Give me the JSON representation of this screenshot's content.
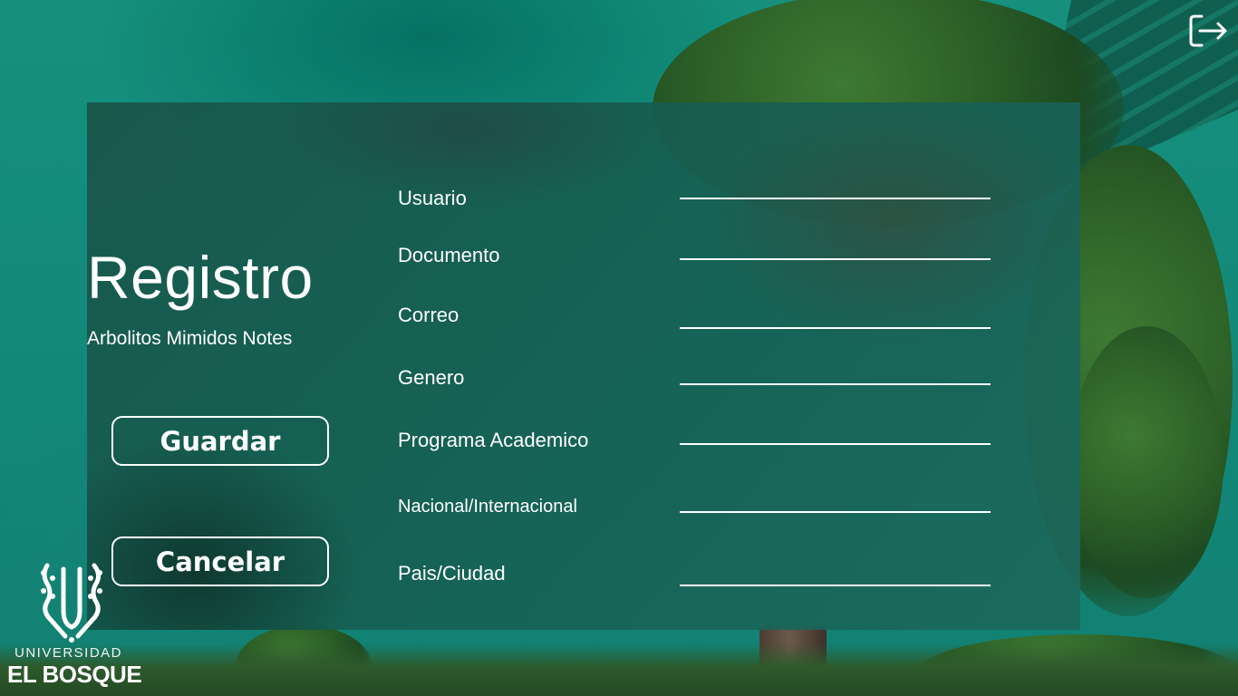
{
  "form": {
    "title": "Registro",
    "subtitle": "Arbolitos Mimidos Notes",
    "fields": [
      {
        "label": "Usuario",
        "value": ""
      },
      {
        "label": "Documento",
        "value": ""
      },
      {
        "label": "Correo",
        "value": ""
      },
      {
        "label": "Genero",
        "value": ""
      },
      {
        "label": "Programa Academico",
        "value": ""
      },
      {
        "label": "Nacional/Internacional",
        "value": ""
      },
      {
        "label": "Pais/Ciudad",
        "value": ""
      }
    ]
  },
  "buttons": {
    "save_label": "Guardar",
    "cancel_label": "Cancelar"
  },
  "header": {
    "exit_icon": "logout-icon"
  },
  "logo": {
    "line1": "UNIVERSIDAD",
    "line2": "EL BOSQUE"
  },
  "colors": {
    "background_teal": "#168a78",
    "text": "#ffffff"
  }
}
